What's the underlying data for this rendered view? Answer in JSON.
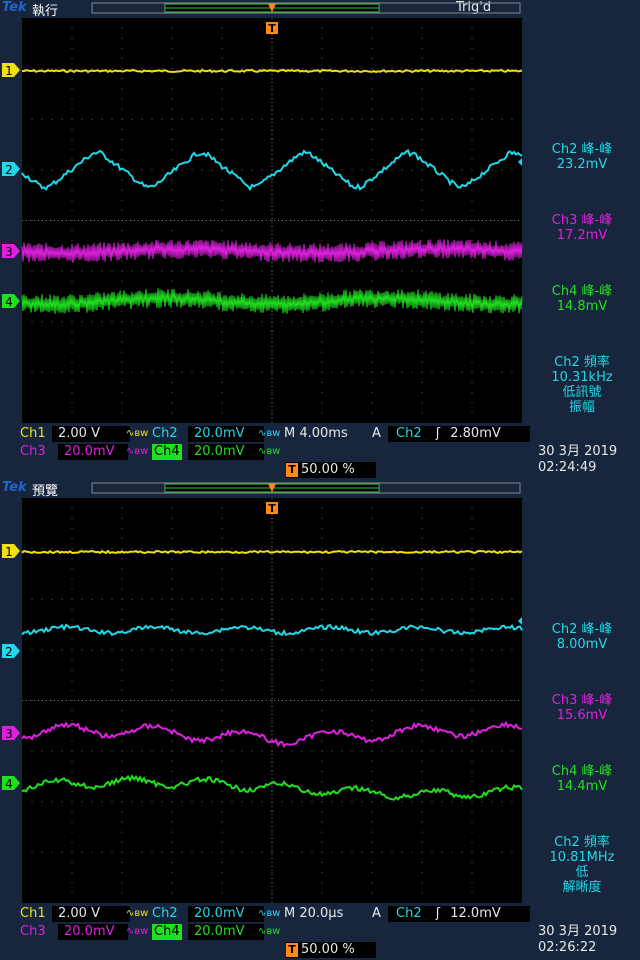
{
  "colors": {
    "ch1": "#f0e010",
    "ch2": "#20d8e8",
    "ch3": "#e020e0",
    "ch4": "#20e020",
    "trigger": "#ff8a10",
    "brand": "#1e66d0"
  },
  "screens": [
    {
      "brand": "Tek",
      "mode": "執行",
      "trig_status": "Trig'd",
      "channel_markers": [
        "1",
        "2",
        "3",
        "4"
      ],
      "trigger_marker": "T",
      "measurements": [
        {
          "label": "Ch2 峰-峰",
          "value": "23.2mV"
        },
        {
          "label": "Ch3 峰-峰",
          "value": "17.2mV"
        },
        {
          "label": "Ch4 峰-峰",
          "value": "14.8mV"
        }
      ],
      "freq": {
        "line1": "Ch2 頻率",
        "line2": "10.31kHz",
        "line3": "低訊號",
        "line4": "振幅"
      },
      "settings": {
        "ch1_label": "Ch1",
        "ch1_scale": "2.00 V",
        "ch2_label": "Ch2",
        "ch2_scale": "20.0mV",
        "ch3_label": "Ch3",
        "ch3_scale": "20.0mV",
        "ch4_label": "Ch4",
        "ch4_scale": "20.0mV",
        "timebase": "M 4.00ms",
        "trig_mode": "A",
        "trig_source": "Ch2",
        "trig_level": "2.80mV",
        "trig_pos": "50.00 %"
      },
      "date": "30 3月  2019",
      "time": "02:24:49"
    },
    {
      "brand": "Tek",
      "mode": "預覽",
      "trig_status": "",
      "channel_markers": [
        "1",
        "2",
        "3",
        "4"
      ],
      "trigger_marker": "T",
      "measurements": [
        {
          "label": "Ch2 峰-峰",
          "value": "8.00mV"
        },
        {
          "label": "Ch3 峰-峰",
          "value": "15.6mV"
        },
        {
          "label": "Ch4 峰-峰",
          "value": "14.4mV"
        }
      ],
      "freq": {
        "line1": "Ch2 頻率",
        "line2": "10.81MHz",
        "line3": "低",
        "line4": "解晰度"
      },
      "settings": {
        "ch1_label": "Ch1",
        "ch1_scale": "2.00 V",
        "ch2_label": "Ch2",
        "ch2_scale": "20.0mV",
        "ch3_label": "Ch3",
        "ch3_scale": "20.0mV",
        "ch4_label": "Ch4",
        "ch4_scale": "20.0mV",
        "timebase": "M 20.0µs",
        "trig_mode": "A",
        "trig_source": "Ch2",
        "trig_level": "12.0mV",
        "trig_pos": "50.00 %"
      },
      "date": "30 3月  2019",
      "time": "02:26:22"
    }
  ]
}
